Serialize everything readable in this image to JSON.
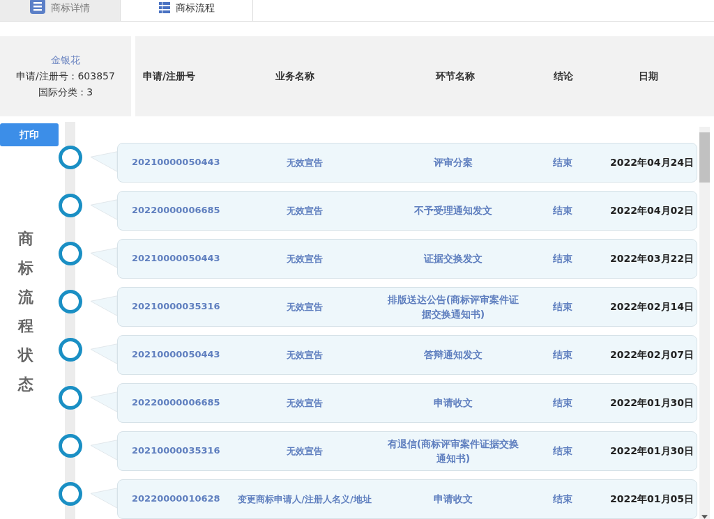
{
  "tabs": [
    {
      "label": "商标详情",
      "selected": false
    },
    {
      "label": "商标流程",
      "selected": true
    }
  ],
  "summary": {
    "name": "金银花",
    "reg_no": "申请/注册号 : 603857",
    "class": "国际分类 : 3"
  },
  "table": {
    "columns": [
      "申请/注册号",
      "业务名称",
      "环节名称",
      "结论",
      "日期"
    ],
    "rows": [
      {
        "number": "20210000050443",
        "business": "无效宣告",
        "stage": "评审分案",
        "result": "结束",
        "date": "2022年04月24日"
      },
      {
        "number": "20220000006685",
        "business": "无效宣告",
        "stage": "不予受理通知发文",
        "result": "结束",
        "date": "2022年04月02日"
      },
      {
        "number": "20210000050443",
        "business": "无效宣告",
        "stage": "证据交换发文",
        "result": "结束",
        "date": "2022年03月22日"
      },
      {
        "number": "20210000035316",
        "business": "无效宣告",
        "stage": "排版送达公告(商标评审案件证据交换通知书)",
        "result": "结束",
        "date": "2022年02月14日"
      },
      {
        "number": "20210000050443",
        "business": "无效宣告",
        "stage": "答辩通知发文",
        "result": "结束",
        "date": "2022年02月07日"
      },
      {
        "number": "20220000006685",
        "business": "无效宣告",
        "stage": "申请收文",
        "result": "结束",
        "date": "2022年01月30日"
      },
      {
        "number": "20210000035316",
        "business": "无效宣告",
        "stage": "有退信(商标评审案件证据交换通知书)",
        "result": "结束",
        "date": "2022年01月30日"
      },
      {
        "number": "20220000010628",
        "business": "变更商标申请人/注册人名义/地址",
        "stage": "申请收文",
        "result": "结束",
        "date": "2022年01月05日"
      }
    ]
  },
  "print_button": "打印",
  "side_label": "商标流程状态"
}
